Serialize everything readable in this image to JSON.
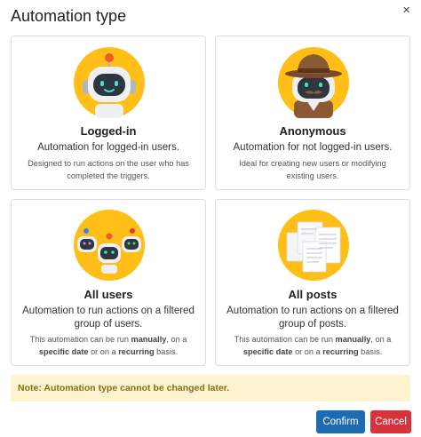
{
  "modal": {
    "title": "Automation type",
    "close_symbol": "×"
  },
  "cards": [
    {
      "title": "Logged-in",
      "subtitle": "Automation for logged-in users.",
      "desc_parts": [
        "Designed to run actions on the user who has completed the triggers."
      ],
      "illustration": "robot-icon"
    },
    {
      "title": "Anonymous",
      "subtitle": "Automation for not logged-in users.",
      "desc_parts": [
        "Ideal for creating new users or modifying existing users."
      ],
      "illustration": "spy-robot-icon"
    },
    {
      "title": "All users",
      "subtitle": "Automation to run actions on a filtered group of users.",
      "desc_parts": [
        "This automation can be run ",
        "manually",
        ", on a ",
        "specific date",
        " or on a ",
        "recurring",
        " basis."
      ],
      "illustration": "robot-group-icon"
    },
    {
      "title": "All posts",
      "subtitle": "Automation to run actions on a filtered group of posts.",
      "desc_parts": [
        "This automation can be run ",
        "manually",
        ", on a ",
        "specific date",
        " or on a ",
        "recurring",
        " basis."
      ],
      "illustration": "documents-icon"
    }
  ],
  "note": "Note: Automation type cannot be changed later.",
  "buttons": {
    "confirm": "Confirm",
    "cancel": "Cancel"
  },
  "colors": {
    "accent_yellow": "#ffbf17",
    "confirm_blue": "#1f6bb0",
    "cancel_red": "#d7333d",
    "note_bg": "#fcf3cf"
  }
}
